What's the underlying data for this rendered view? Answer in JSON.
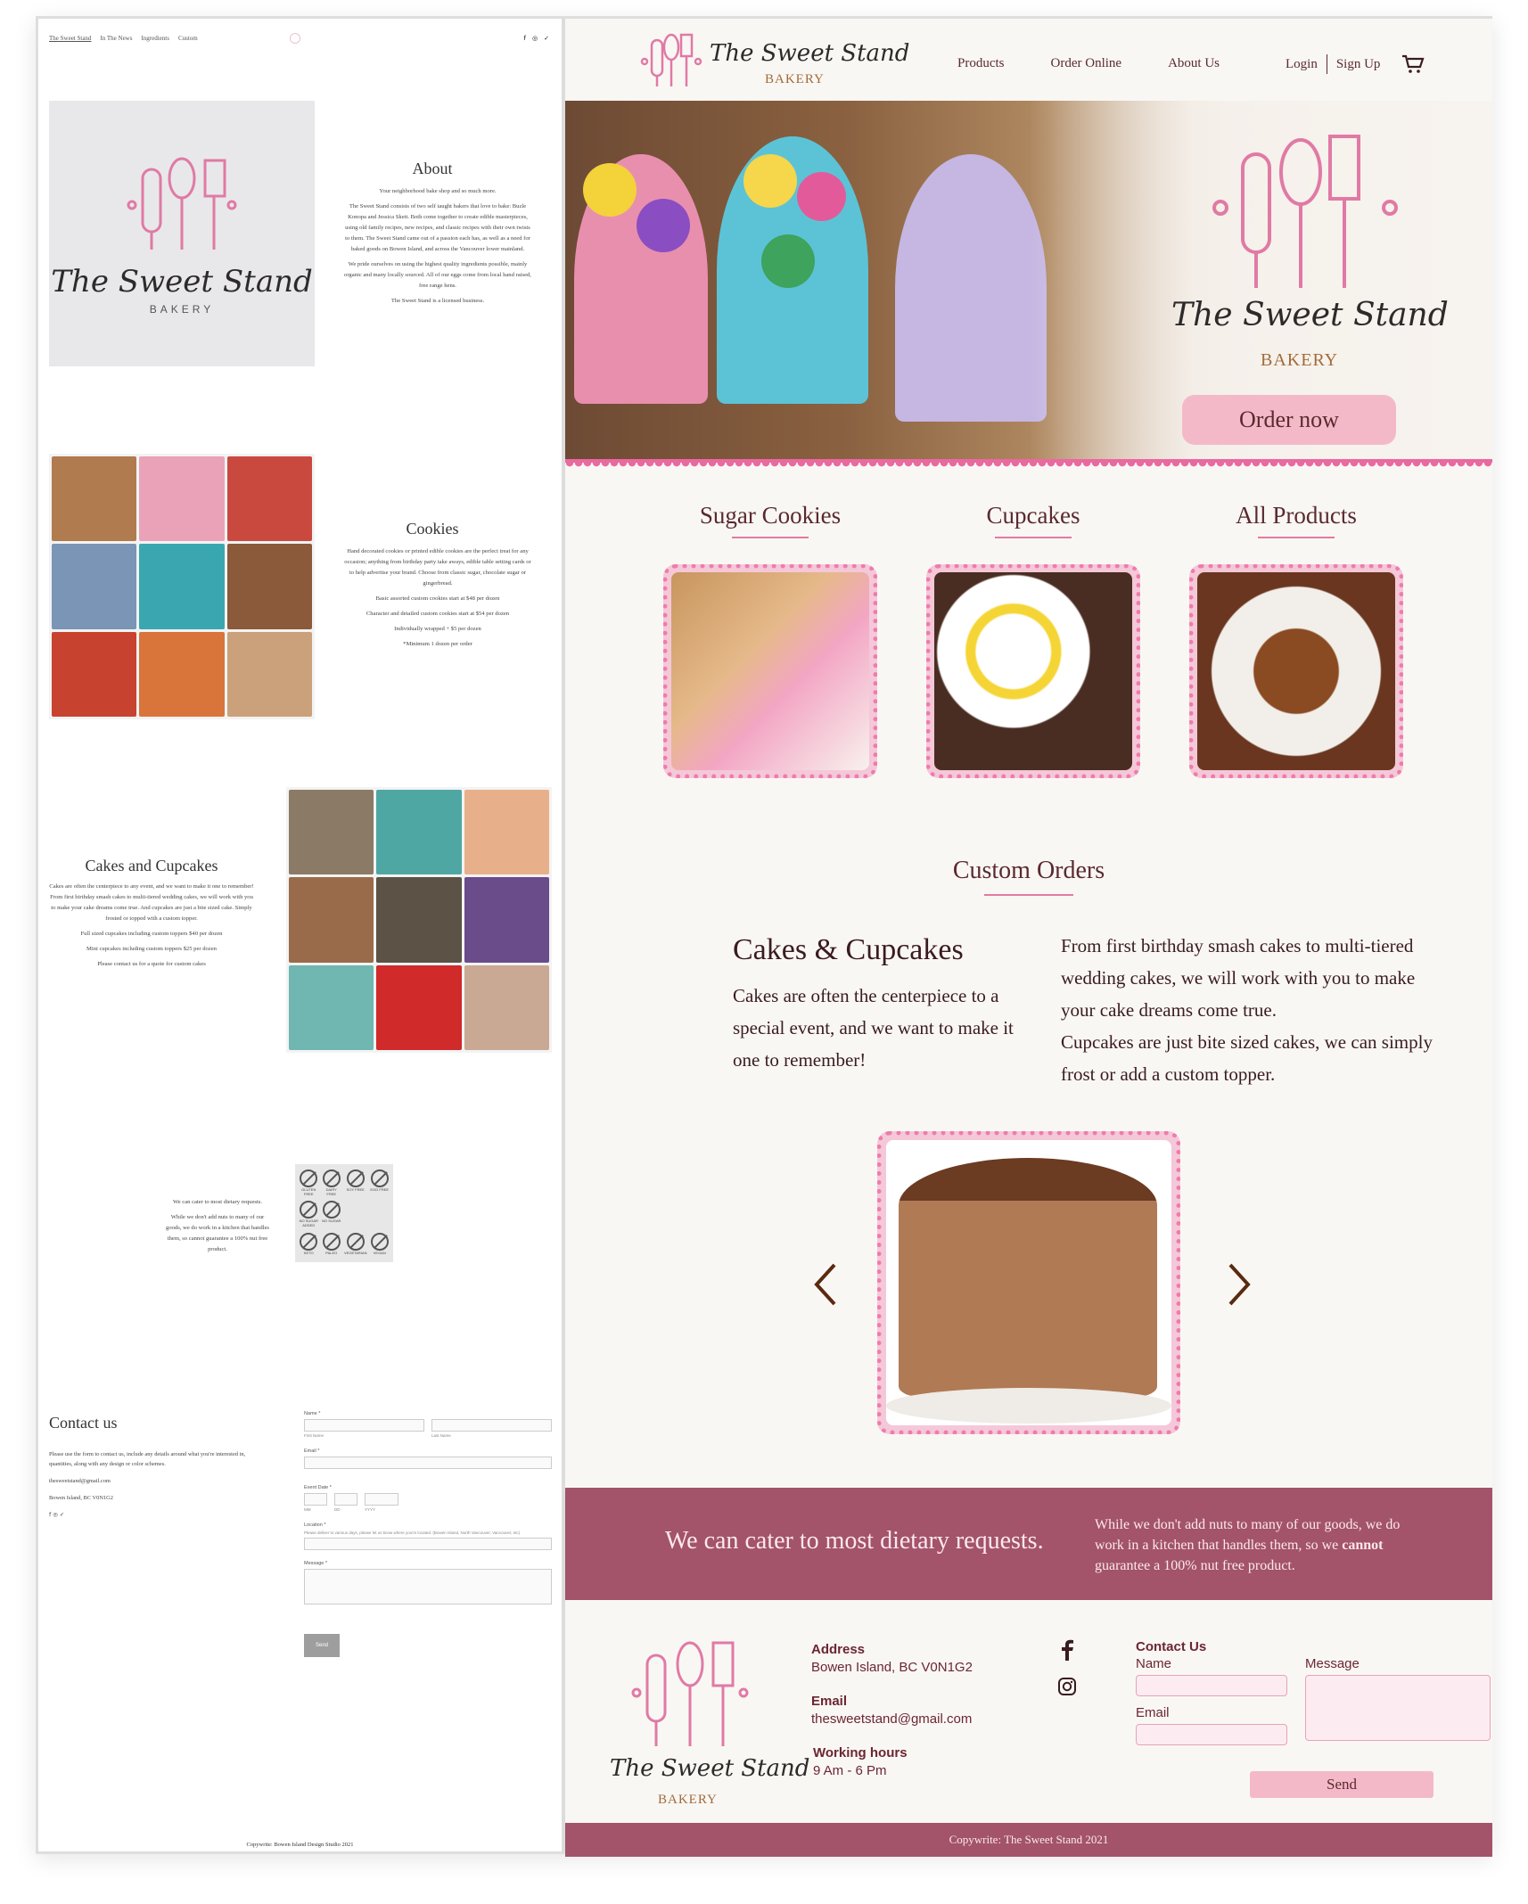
{
  "old_site": {
    "nav": [
      "The Sweet Stand",
      "In The News",
      "Ingredients",
      "Custom"
    ],
    "social": [
      "f",
      "◎",
      "✓"
    ],
    "logo": {
      "script": "The Sweet Stand",
      "bakery": "BAKERY"
    },
    "about": {
      "title": "About",
      "paragraphs": [
        "Your neighborhood bake shop and so much more.",
        "The Sweet Stand consists of two self taught bakers that love to bake: Buzle Konopa and Jessica Skett. Both come together to create edible masterpieces, using old family recipes, new recipes, and classic recipes with their own twists to them. The Sweet Stand came out of a passion each has, as well as a need for baked goods on Bowen Island, and across the Vancouver lower mainland.",
        "We pride ourselves on using the highest quality ingredients possible, mainly organic and many locally sourced. All of our eggs come from local hand raised, free range hens.",
        "The Sweet Stand is a licensed business."
      ]
    },
    "cookies": {
      "title": "Cookies",
      "paragraphs": [
        "Hand decorated cookies or printed edible cookies are the perfect treat for any occasion; anything from birthday party take aways, edible table setting cards or to help advertise your brand. Choose from classic sugar, chocolate sugar or gingerbread.",
        "Basic assorted custom cookies start at $48 per dozen",
        "Character and detailed custom cookies start at $54 per dozen",
        "Individually wrapped + $5 per dozen",
        "*Minimum 1 dozen per order"
      ]
    },
    "cakes": {
      "title": "Cakes and Cupcakes",
      "paragraphs": [
        "Cakes are often the centerpiece to any event, and we want to make it one to remember! From first birthday smash cakes to multi-tiered wedding cakes, we will work with you to make your cake dreams come true. And cupcakes are just a bite sized cake. Simply frosted or topped with a custom topper.",
        "Full sized cupcakes including custom toppers $40 per dozen",
        "Mini cupcakes including custom toppers $25 per dozen",
        "Please contact us for a quote for custom cakes"
      ]
    },
    "diet": {
      "paragraphs": [
        "We can cater to most dietary requests.",
        "While we don't add nuts to many of our goods, we do work in a kitchen that handles them, so cannot guarantee a 100% nut free product."
      ],
      "icons": [
        "GLUTEN FREE",
        "DAIRY FREE",
        "SOY FREE",
        "EGG FREE",
        "NO SUGAR ADDED",
        "NO SUGAR",
        "KETO",
        "PALEO",
        "VEGETARIAN",
        "VEGAN"
      ]
    },
    "contact": {
      "title": "Contact us",
      "text": "Please use the form to contact us, include any details around what you're interested in, quantities, along with any design or color schemes.",
      "email": "thesweetstand@gmail.com",
      "address": "Bowen Island, BC V0N1G2",
      "form": {
        "name": "Name *",
        "first": "First Name",
        "last": "Last Name",
        "email": "Email *",
        "date": "Event Date *",
        "mm": "MM",
        "dd": "DD",
        "yyyy": "YYYY",
        "location": "Location *",
        "location_hint": "Please deliver to various days, please let us know where you're located. (Bowen Island, North Vancouver, Vancouver, etc)",
        "message": "Message *",
        "send": "Send"
      }
    },
    "footer": "Copywrite: Bowen Island Design Studio 2021"
  },
  "new_site": {
    "brand": {
      "script": "The Sweet Stand",
      "bakery": "BAKERY"
    },
    "nav": {
      "products": "Products",
      "order": "Order Online",
      "about": "About Us",
      "login": "Login",
      "signup": "Sign Up"
    },
    "hero": {
      "button": "Order now"
    },
    "categories": [
      {
        "title": "Sugar Cookies"
      },
      {
        "title": "Cupcakes"
      },
      {
        "title": "All Products"
      }
    ],
    "custom": {
      "title": "Custom Orders",
      "heading": "Cakes & Cupcakes",
      "left": "Cakes are often the centerpiece to a special event, and we want to make it one to remember!",
      "right": "From first birthday smash cakes to multi-tiered wedding cakes, we will work with you to make your cake dreams come true.",
      "right2": "Cupcakes are just bite sized cakes, we can simply frost or add a custom topper."
    },
    "diet_band": {
      "left": "We can cater to most dietary requests.",
      "right_a": "While we don't add nuts to many of our goods, we do work in a kitchen that handles them, so we",
      "right_bold": "cannot",
      "right_b": "guarantee a 100% nut free product."
    },
    "footer": {
      "address_label": "Address",
      "address": "Bowen Island, BC V0N1G2",
      "email_label": "Email",
      "email": "thesweetstand@gmail.com",
      "hours_label": "Working hours",
      "hours": "9 Am - 6 Pm",
      "contact_label": "Contact Us",
      "name_label": "Name",
      "email_field": "Email",
      "message_label": "Message",
      "send": "Send",
      "copyright": "Copywrite: The Sweet Stand 2021"
    },
    "colors": {
      "accent_pink": "#f4b9c8",
      "scallop": "#e86aa0",
      "band": "#a3536a",
      "text": "#5a2a2e"
    }
  }
}
